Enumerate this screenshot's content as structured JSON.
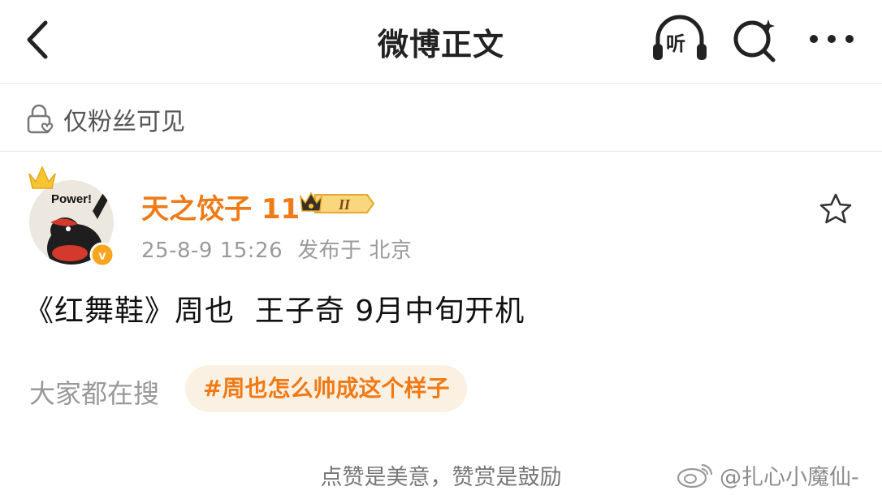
{
  "header": {
    "title": "微博正文",
    "listen_label": "听",
    "icons": {
      "back": "chevron-left-icon",
      "listen": "headphones-icon",
      "search": "search-sparkle-icon",
      "more": "more-dots-icon"
    }
  },
  "visibility": {
    "icon": "lock-heart-icon",
    "label": "仅粉丝可见"
  },
  "post": {
    "avatar": {
      "badge_text": "Power!",
      "verified_mark": "v",
      "crown_color": "#f7c531"
    },
    "username": "天之饺子 11",
    "level_badge": "II",
    "date": "25-8-9 15:26",
    "published_from": "发布于 北京",
    "text": "《红舞鞋》周也  王子奇 9月中旬开机"
  },
  "hot_search": {
    "label": "大家都在搜",
    "tag": "#周也怎么帅成这个样子"
  },
  "footer": {
    "praise_text": "点赞是美意，赞赏是鼓励"
  },
  "watermark": {
    "text": "@扎心小魔仙-"
  },
  "colors": {
    "accent_orange": "#f07a16",
    "tag_bg": "#fbf1e3",
    "divider": "#e8e8e8"
  }
}
